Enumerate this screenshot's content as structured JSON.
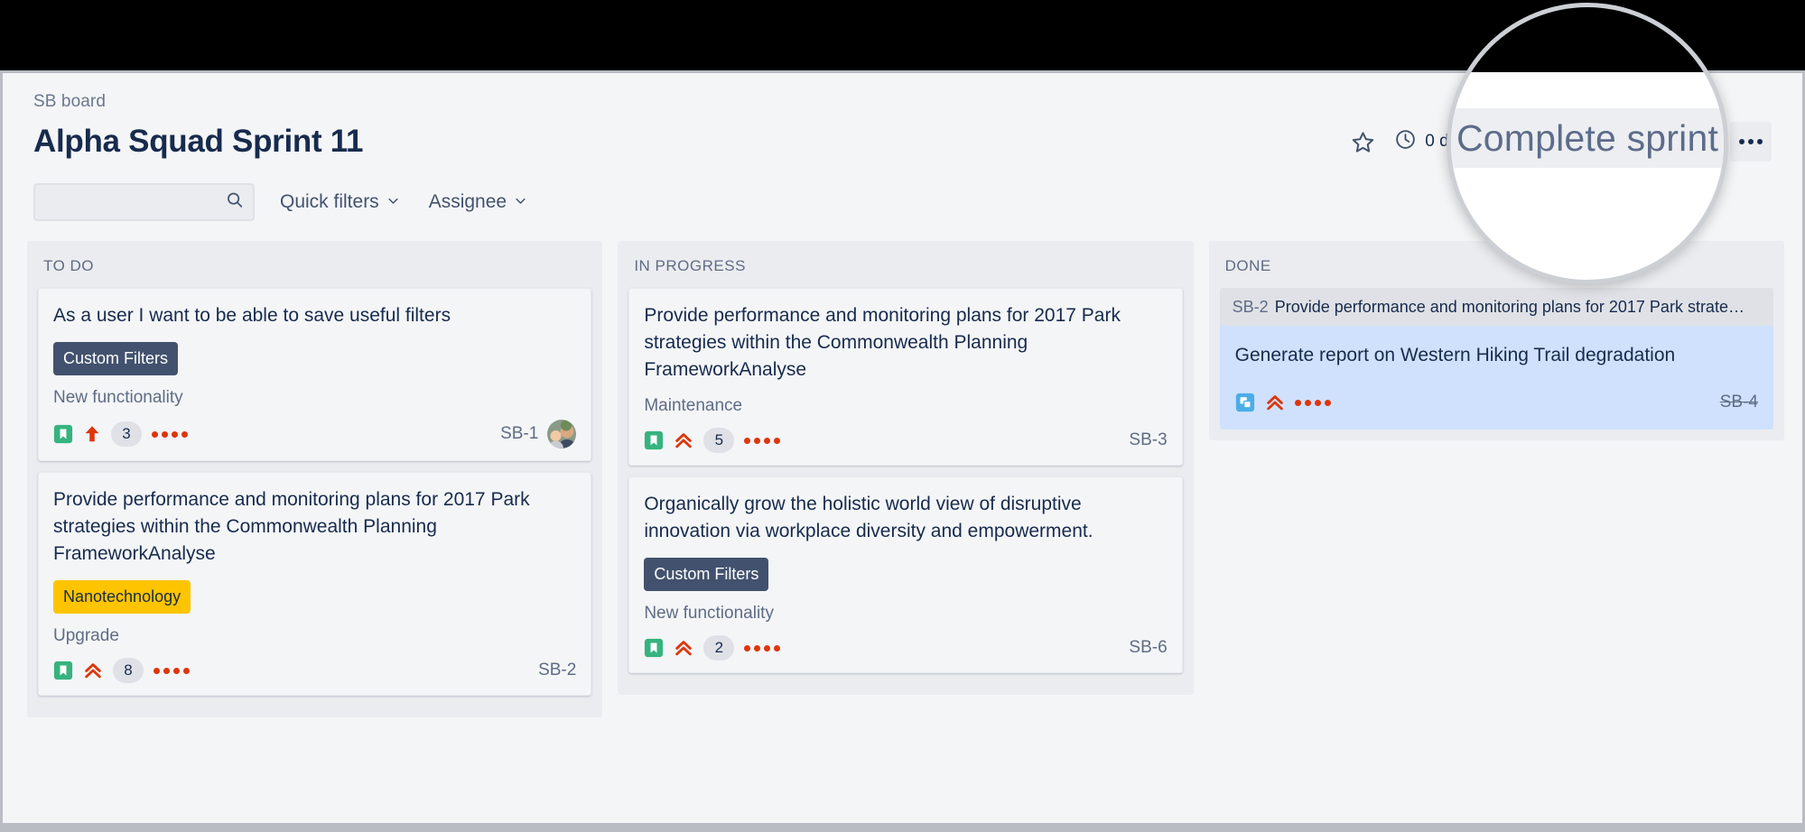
{
  "window": {
    "frame_color": "#b9bcc2",
    "page_background": "#f4f5f7"
  },
  "header": {
    "breadcrumb": "SB board",
    "title": "Alpha Squad Sprint 11",
    "star_icon": "star-icon",
    "clock_icon": "clock-icon",
    "days_remaining": "0 days remaining",
    "complete_sprint_label": "Complete sprint",
    "more_actions_label": "•••"
  },
  "filters": {
    "search_value": "",
    "search_placeholder": "",
    "search_icon": "search-icon",
    "quick_filters_label": "Quick filters",
    "assignee_label": "Assignee",
    "chevron_icon": "chevron-down-icon"
  },
  "magnifier": {
    "zoomed_text": "Complete sprint",
    "border_color": "#cccfd4"
  },
  "colors": {
    "column_bg": "#ebecf0",
    "card_bg": "#f4f5f7",
    "selected_card_bg": "#cfe1fd",
    "label_blue": "#42526e",
    "label_yellow": "#ffc400",
    "priority_red": "#de350b",
    "story_green": "#36b37e",
    "task_blue": "#2684ff",
    "text_primary": "#172b4d",
    "text_subtle": "#5e6c84"
  },
  "board": {
    "columns": [
      {
        "name": "todo",
        "title": "TO DO",
        "cards": [
          {
            "title": "As a user I want to be able to save useful filters",
            "label": "Custom Filters",
            "label_style": "chip-blue",
            "epic": "New functionality",
            "type_icon": "story-bookmark-icon",
            "priority_icon": "priority-high-arrow-up-icon",
            "estimate": "3",
            "flag_dots": 4,
            "key": "SB-1",
            "avatar": "user-avatar",
            "has_avatar": true
          },
          {
            "title": "Provide performance and monitoring plans for 2017 Park strategies within the Commonwealth Planning FrameworkAnalyse",
            "label": "Nanotechnology",
            "label_style": "chip-yellow",
            "epic": "Upgrade",
            "type_icon": "story-bookmark-icon",
            "priority_icon": "priority-highest-chevrons-up-icon",
            "estimate": "8",
            "flag_dots": 4,
            "key": "SB-2",
            "has_avatar": false
          }
        ]
      },
      {
        "name": "inprogress",
        "title": "IN PROGRESS",
        "cards": [
          {
            "title": "Provide performance and monitoring plans for 2017 Park strategies within the Commonwealth Planning FrameworkAnalyse",
            "label": "",
            "label_style": "",
            "epic": "Maintenance",
            "type_icon": "story-bookmark-icon",
            "priority_icon": "priority-highest-chevrons-up-icon",
            "estimate": "5",
            "flag_dots": 4,
            "key": "SB-3",
            "has_avatar": false
          },
          {
            "title": "Organically grow the holistic world view of disruptive innovation via workplace diversity and empowerment.",
            "label": "Custom Filters",
            "label_style": "chip-blue",
            "epic": "New functionality",
            "type_icon": "story-bookmark-icon",
            "priority_icon": "priority-highest-chevrons-up-icon",
            "estimate": "2",
            "flag_dots": 4,
            "key": "SB-6",
            "has_avatar": false
          }
        ]
      },
      {
        "name": "done",
        "title": "DONE",
        "group": {
          "parent_key": "SB-2",
          "parent_summary": "Provide performance and monitoring plans for 2017 Park strate…"
        },
        "cards": [
          {
            "title": "Generate report on Western Hiking Trail degradation",
            "label": "",
            "label_style": "",
            "epic": "",
            "type_icon": "subtask-squares-icon",
            "priority_icon": "priority-highest-chevrons-up-icon",
            "estimate": "",
            "flag_dots": 4,
            "key": "SB-4",
            "key_struck": true,
            "selected": true,
            "has_avatar": false
          }
        ]
      }
    ]
  }
}
